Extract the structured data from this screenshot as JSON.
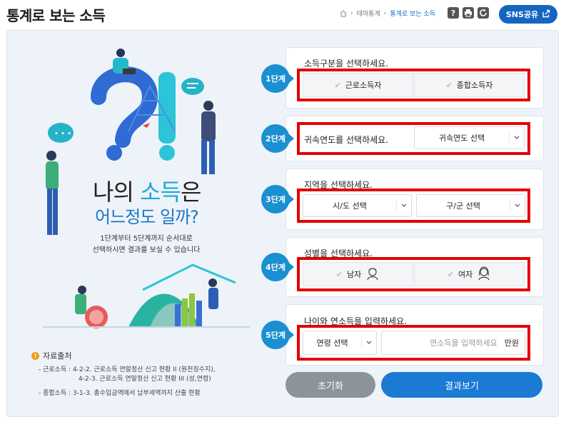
{
  "header": {
    "title": "통계로 보는 소득",
    "breadcrumb": [
      "테마통계",
      "통계로 보는 소득"
    ],
    "sns_label": "SNS공유"
  },
  "left": {
    "headline_part1": "나의 ",
    "headline_highlight": "소득",
    "headline_part2": "은",
    "headline_line2": "어느정도 일까?",
    "desc_line1": "1단계부터 5단계까지 순서대로",
    "desc_line2": "선택하시면 결과를 보실 수 있습니다",
    "source_title": "자료출처",
    "sources": [
      {
        "label": "- 근로소득 :",
        "text": "4-2-2. 근로소득 연말정산 신고 현황 II (원천징수지),"
      },
      {
        "label": "",
        "text": "4-2-3. 근로소득 연말정산 신고 현황 III (성,연령)"
      },
      {
        "label": "- 종합소득 :",
        "text": "3-1-3. 총수입금액에서 납부세액까지 산출 현황"
      }
    ]
  },
  "steps": {
    "s1": {
      "badge": "1단계",
      "question": "소득구분을 선택하세요.",
      "options": [
        "근로소득자",
        "종합소득자"
      ]
    },
    "s2": {
      "badge": "2단계",
      "question": "귀속연도를 선택하세요.",
      "select": "귀속연도 선택"
    },
    "s3": {
      "badge": "3단계",
      "question": "지역을 선택하세요.",
      "select_city": "시/도 선택",
      "select_district": "구/군 선택"
    },
    "s4": {
      "badge": "4단계",
      "question": "성별을 선택하세요.",
      "options": [
        "남자",
        "여자"
      ]
    },
    "s5": {
      "badge": "5단계",
      "question": "나이와 연소득을 입력하세요.",
      "select_age": "연령 선택",
      "income_placeholder": "연소득을 입력하세요",
      "unit": "만원"
    }
  },
  "actions": {
    "reset": "초기화",
    "result": "결과보기"
  },
  "colors": {
    "accent": "#1a7ad4",
    "badge": "#1a8fd1",
    "highlight_box": "#e30000",
    "headline_accent": "#1aa9d6"
  }
}
